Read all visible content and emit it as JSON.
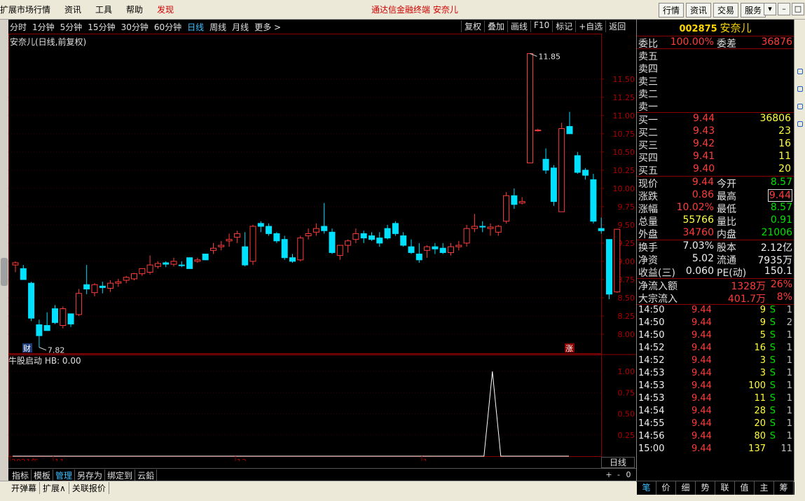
{
  "menu": {
    "left_items": [
      "扩展市场行情",
      "资讯",
      "工具",
      "帮助",
      "发现"
    ],
    "center_title": "通达信金融终端   安奈儿",
    "right_tabs": [
      "行情",
      "资讯",
      "交易",
      "服务"
    ],
    "window_buttons": [
      "▾",
      "–",
      "□",
      "✕"
    ]
  },
  "periods": [
    "分时",
    "1分钟",
    "5分钟",
    "15分钟",
    "30分钟",
    "60分钟",
    "日线",
    "周线",
    "月线",
    "更多 >"
  ],
  "active_period": "日线",
  "toolbar": [
    "复权",
    "叠加",
    "画线",
    "F10",
    "标记",
    "+自选",
    "返回"
  ],
  "chart": {
    "title": "安奈儿(日线,前复权)",
    "indicator_title": "牛股启动 HB: 0.00",
    "high_label": "11.85",
    "low_label": "7.82",
    "cai_badge": "财",
    "zhang_badge": "涨",
    "dayline_label": "日线",
    "x_labels": [
      "2021年",
      "11",
      "12",
      "1"
    ]
  },
  "chart_data": {
    "type": "candlestick",
    "y_ticks": [
      "11.50",
      "11.25",
      "11.00",
      "10.75",
      "10.50",
      "10.25",
      "10.00",
      "9.75",
      "9.50",
      "9.25",
      "9.00",
      "8.75",
      "8.50",
      "8.25",
      "8.00"
    ],
    "ylim": [
      7.75,
      11.95
    ],
    "indicator_ticks": [
      "1.00",
      "0.75",
      "0.50",
      "0.25"
    ],
    "indicator_ylim": [
      0,
      1.1
    ],
    "indicator_spike_index": 56,
    "candles": [
      [
        8.95,
        9.0,
        8.98,
        8.85
      ],
      [
        8.9,
        8.95,
        8.75,
        8.75
      ],
      [
        8.7,
        8.72,
        8.22,
        8.18
      ],
      [
        8.13,
        8.2,
        7.98,
        7.82
      ],
      [
        8.12,
        8.3,
        8.05,
        8.05
      ],
      [
        8.35,
        8.4,
        8.16,
        8.14
      ],
      [
        8.12,
        8.38,
        8.35,
        8.08
      ],
      [
        8.28,
        8.28,
        8.14,
        8.1
      ],
      [
        8.27,
        8.62,
        8.56,
        8.25
      ],
      [
        8.68,
        8.95,
        8.62,
        8.55
      ],
      [
        8.57,
        8.7,
        8.68,
        8.52
      ],
      [
        8.66,
        8.72,
        8.64,
        8.56
      ],
      [
        8.63,
        8.74,
        8.7,
        8.58
      ],
      [
        8.7,
        8.76,
        8.72,
        8.65
      ],
      [
        8.74,
        8.8,
        8.78,
        8.7
      ],
      [
        8.76,
        8.84,
        8.83,
        8.74
      ],
      [
        8.83,
        8.88,
        8.9,
        8.8
      ],
      [
        8.85,
        9.08,
        8.95,
        8.82
      ],
      [
        8.93,
        9.0,
        8.97,
        8.9
      ],
      [
        8.98,
        9.0,
        8.96,
        8.92
      ],
      [
        8.96,
        9.05,
        9.0,
        8.93
      ],
      [
        8.95,
        9.0,
        8.94,
        8.92
      ],
      [
        9.05,
        9.0,
        8.9,
        8.92
      ],
      [
        9.0,
        9.05,
        9.02,
        8.98
      ],
      [
        9.1,
        9.1,
        9.02,
        9.02
      ],
      [
        9.15,
        9.25,
        9.18,
        9.1
      ],
      [
        9.2,
        9.28,
        9.22,
        9.15
      ],
      [
        9.28,
        9.38,
        9.3,
        9.2
      ],
      [
        9.33,
        9.42,
        9.38,
        9.25
      ],
      [
        9.2,
        9.4,
        8.95,
        8.93
      ],
      [
        9.0,
        9.5,
        9.48,
        8.95
      ],
      [
        9.52,
        9.55,
        9.48,
        9.4
      ],
      [
        9.48,
        9.52,
        9.38,
        9.35
      ],
      [
        9.38,
        9.4,
        9.28,
        9.25
      ],
      [
        9.3,
        9.35,
        9.05,
        9.02
      ],
      [
        9.05,
        9.1,
        9.0,
        8.98
      ],
      [
        9.02,
        9.35,
        9.32,
        9.0
      ],
      [
        9.35,
        9.45,
        9.38,
        9.3
      ],
      [
        9.4,
        9.52,
        9.45,
        9.35
      ],
      [
        9.48,
        9.8,
        9.42,
        9.38
      ],
      [
        9.4,
        9.45,
        9.12,
        9.1
      ],
      [
        9.08,
        9.2,
        9.22,
        9.02
      ],
      [
        9.22,
        9.3,
        9.28,
        9.12
      ],
      [
        9.3,
        9.45,
        9.38,
        9.25
      ],
      [
        9.38,
        9.42,
        9.32,
        9.25
      ],
      [
        9.35,
        9.4,
        9.3,
        9.28
      ],
      [
        9.32,
        9.4,
        9.25,
        9.2
      ],
      [
        9.45,
        9.5,
        9.32,
        9.3
      ],
      [
        9.52,
        9.55,
        9.38,
        9.35
      ],
      [
        9.35,
        9.4,
        9.22,
        9.2
      ],
      [
        9.2,
        9.3,
        9.12,
        9.1
      ],
      [
        9.1,
        9.25,
        9.02,
        8.98
      ],
      [
        9.15,
        9.22,
        9.2,
        9.05
      ],
      [
        9.2,
        9.25,
        9.17,
        9.1
      ],
      [
        9.18,
        9.25,
        9.12,
        9.1
      ],
      [
        9.12,
        9.25,
        9.2,
        9.08
      ],
      [
        9.2,
        9.28,
        9.22,
        9.15
      ],
      [
        9.25,
        9.5,
        9.45,
        9.2
      ],
      [
        9.45,
        9.65,
        9.48,
        9.4
      ],
      [
        9.48,
        9.55,
        9.47,
        9.4
      ],
      [
        9.45,
        9.52,
        9.47,
        9.35
      ],
      [
        9.4,
        9.5,
        9.48,
        9.35
      ],
      [
        9.55,
        9.95,
        9.9,
        9.52
      ],
      [
        9.9,
        10.0,
        9.78,
        9.72
      ],
      [
        9.8,
        9.88,
        9.82,
        9.78
      ],
      [
        10.35,
        11.85,
        11.85,
        10.35
      ],
      [
        10.8,
        10.82,
        10.8,
        10.78
      ],
      [
        10.4,
        10.55,
        10.25,
        10.2
      ],
      [
        10.28,
        10.32,
        9.82,
        9.76
      ],
      [
        9.68,
        10.9,
        10.82,
        9.68
      ],
      [
        10.85,
        11.05,
        10.75,
        10.75
      ],
      [
        10.45,
        10.5,
        10.22,
        10.2
      ],
      [
        10.25,
        10.28,
        10.18,
        10.12
      ],
      [
        10.12,
        10.2,
        9.55,
        9.52
      ],
      [
        9.45,
        9.6,
        9.42,
        9.38
      ],
      [
        9.3,
        9.3,
        8.55,
        8.48
      ],
      [
        8.58,
        9.44,
        9.44,
        8.57
      ]
    ]
  },
  "quote": {
    "code": "002875",
    "name": "安奈儿",
    "weibi_label": "委比",
    "weibi_value": "100.00%",
    "weicha_label": "委差",
    "weicha_value": "36876",
    "sell_labels": [
      "卖五",
      "卖四",
      "卖三",
      "卖二",
      "卖一"
    ],
    "buys": [
      {
        "label": "买一",
        "price": "9.44",
        "vol": "36806"
      },
      {
        "label": "买二",
        "price": "9.43",
        "vol": "23"
      },
      {
        "label": "买三",
        "price": "9.42",
        "vol": "16"
      },
      {
        "label": "买四",
        "price": "9.41",
        "vol": "11"
      },
      {
        "label": "买五",
        "price": "9.40",
        "vol": "20"
      }
    ],
    "stats1": [
      {
        "l1": "现价",
        "v1": "9.44",
        "c1": "red",
        "l2": "今开",
        "v2": "8.57",
        "c2": "green"
      },
      {
        "l1": "涨跌",
        "v1": "0.86",
        "c1": "red",
        "l2": "最高",
        "v2": "9.44",
        "c2": "red-box"
      },
      {
        "l1": "涨幅",
        "v1": "10.02%",
        "c1": "red",
        "l2": "最低",
        "v2": "8.57",
        "c2": "green"
      },
      {
        "l1": "总量",
        "v1": "55766",
        "c1": "yellow",
        "l2": "量比",
        "v2": "0.91",
        "c2": "green"
      },
      {
        "l1": "外盘",
        "v1": "34760",
        "c1": "red",
        "l2": "内盘",
        "v2": "21006",
        "c2": "green"
      }
    ],
    "stats2": [
      {
        "l1": "换手",
        "v1": "7.03%",
        "l2": "股本",
        "v2": "2.12亿"
      },
      {
        "l1": "净资",
        "v1": "5.02",
        "l2": "流通",
        "v2": "7935万"
      },
      {
        "l1": "收益(三)",
        "v1": "0.060",
        "l2": "PE(动)",
        "v2": "150.1"
      }
    ],
    "flows": [
      {
        "label": "净流入额",
        "value": "1328万",
        "pct": "26%"
      },
      {
        "label": "大宗流入",
        "value": "401.7万",
        "pct": "8%"
      }
    ],
    "ticks": [
      {
        "t": "14:50",
        "p": "9.44",
        "v": "9",
        "s": "S",
        "c": "1"
      },
      {
        "t": "14:50",
        "p": "9.44",
        "v": "9",
        "s": "S",
        "c": "2"
      },
      {
        "t": "14:50",
        "p": "9.44",
        "v": "5",
        "s": "S",
        "c": "1"
      },
      {
        "t": "14:52",
        "p": "9.44",
        "v": "16",
        "s": "S",
        "c": "1"
      },
      {
        "t": "14:52",
        "p": "9.44",
        "v": "3",
        "s": "S",
        "c": "1"
      },
      {
        "t": "14:53",
        "p": "9.44",
        "v": "3",
        "s": "S",
        "c": "1"
      },
      {
        "t": "14:53",
        "p": "9.44",
        "v": "100",
        "s": "S",
        "c": "1"
      },
      {
        "t": "14:53",
        "p": "9.44",
        "v": "11",
        "s": "S",
        "c": "1"
      },
      {
        "t": "14:54",
        "p": "9.44",
        "v": "28",
        "s": "S",
        "c": "1"
      },
      {
        "t": "14:55",
        "p": "9.44",
        "v": "20",
        "s": "S",
        "c": "1"
      },
      {
        "t": "14:56",
        "p": "9.44",
        "v": "80",
        "s": "S",
        "c": "1"
      },
      {
        "t": "15:00",
        "p": "9.44",
        "v": "137",
        "s": "",
        "c": "11"
      }
    ],
    "bottom_tabs": [
      "笔",
      "价",
      "细",
      "势",
      "联",
      "值",
      "主",
      "筹"
    ]
  },
  "bottom_tabs": [
    "指标",
    "模板",
    "管理",
    "另存为",
    "绑定到",
    "云鉛"
  ],
  "active_bottom_tab": "管理",
  "zoom_buttons": [
    "+",
    "-",
    "0"
  ],
  "status_items": [
    "开弹幕",
    "扩展∧",
    "关联报价"
  ],
  "colors": {
    "up": "#ff3c3c",
    "down": "#00e0ff",
    "grid": "#8b0000"
  }
}
